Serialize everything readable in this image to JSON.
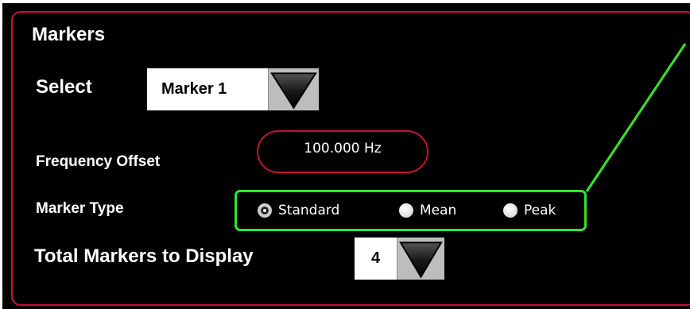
{
  "markers_panel": {
    "title": "Markers",
    "select": {
      "label": "Select",
      "value": "Marker 1",
      "button_icon": "triangle-down-icon"
    },
    "frequency_offset": {
      "label": "Frequency Offset",
      "value": "100.000 Hz"
    },
    "marker_type": {
      "label": "Marker Type",
      "options": [
        "Standard",
        "Mean",
        "Peak"
      ],
      "selected": "Standard"
    },
    "total_markers": {
      "label": "Total Markers to Display",
      "value": "4",
      "button_icon": "triangle-down-icon"
    }
  },
  "colors": {
    "panel_background": "#000000",
    "panel_border": "#c8102e",
    "highlight": "#33e62a",
    "text": "#ffffff"
  }
}
